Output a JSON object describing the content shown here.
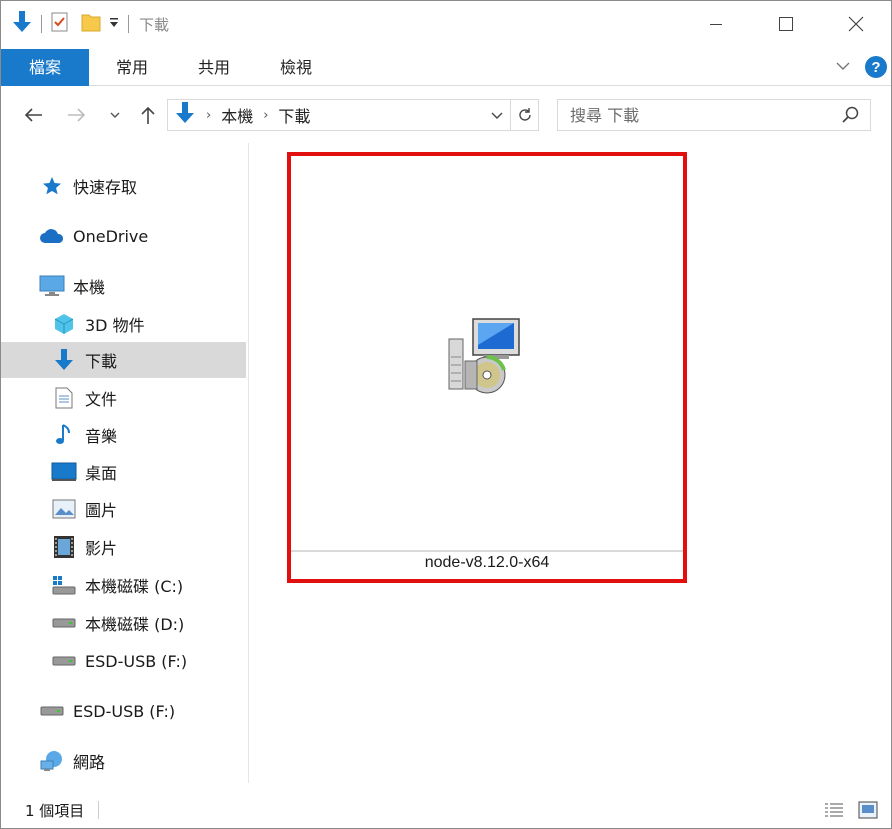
{
  "title": "下載",
  "ribbon": {
    "tabs": [
      {
        "label": "檔案"
      },
      {
        "label": "常用"
      },
      {
        "label": "共用"
      },
      {
        "label": "檢視"
      }
    ],
    "accent": "#1979ca",
    "help_label": "?"
  },
  "address": {
    "crumbs": [
      "本機",
      "下載"
    ]
  },
  "search": {
    "placeholder": "搜尋 下載"
  },
  "sidebar": {
    "items": [
      {
        "label": "快速存取",
        "icon": "star-icon"
      },
      {
        "label": "OneDrive",
        "icon": "cloud-icon"
      },
      {
        "label": "本機",
        "icon": "monitor-icon"
      },
      {
        "label": "3D 物件",
        "icon": "cube-icon"
      },
      {
        "label": "下載",
        "icon": "download-arrow-icon",
        "selected": true
      },
      {
        "label": "文件",
        "icon": "document-icon"
      },
      {
        "label": "音樂",
        "icon": "music-note-icon"
      },
      {
        "label": "桌面",
        "icon": "desktop-icon"
      },
      {
        "label": "圖片",
        "icon": "picture-icon"
      },
      {
        "label": "影片",
        "icon": "film-icon"
      },
      {
        "label": "本機磁碟 (C:)",
        "icon": "system-drive-icon"
      },
      {
        "label": "本機磁碟 (D:)",
        "icon": "drive-icon"
      },
      {
        "label": "ESD-USB (F:)",
        "icon": "usb-drive-icon"
      },
      {
        "label": "ESD-USB (F:)",
        "icon": "usb-drive-icon"
      },
      {
        "label": "網路",
        "icon": "network-icon"
      }
    ]
  },
  "content": {
    "files": [
      {
        "name": "node-v8.12.0-x64",
        "icon": "installer-icon"
      }
    ],
    "highlight_color": "#e20f0f"
  },
  "status": {
    "item_count": "1 個項目"
  }
}
